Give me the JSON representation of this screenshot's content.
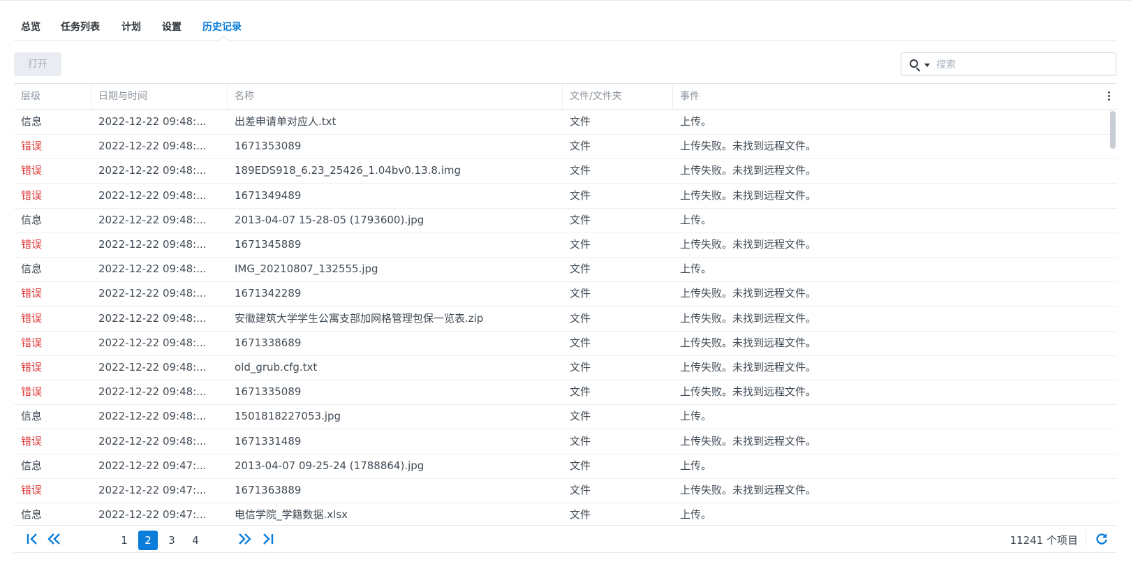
{
  "tabs": [
    {
      "label": "总览"
    },
    {
      "label": "任务列表"
    },
    {
      "label": "计划"
    },
    {
      "label": "设置"
    },
    {
      "label": "历史记录",
      "active": true
    }
  ],
  "toolbar": {
    "open_label": "打开",
    "search_placeholder": "搜索"
  },
  "table": {
    "columns": [
      "层级",
      "日期与时间",
      "名称",
      "文件/文件夹",
      "事件"
    ],
    "rows": [
      {
        "level": "信息",
        "error": false,
        "datetime": "2022-12-22 09:48:...",
        "name": "出差申请单对应人.txt",
        "type": "文件",
        "event": "上传。"
      },
      {
        "level": "错误",
        "error": true,
        "datetime": "2022-12-22 09:48:...",
        "name": "1671353089",
        "type": "文件",
        "event": "上传失败。未找到远程文件。"
      },
      {
        "level": "错误",
        "error": true,
        "datetime": "2022-12-22 09:48:...",
        "name": "189EDS918_6.23_25426_1.04bv0.13.8.img",
        "type": "文件",
        "event": "上传失败。未找到远程文件。"
      },
      {
        "level": "错误",
        "error": true,
        "datetime": "2022-12-22 09:48:...",
        "name": "1671349489",
        "type": "文件",
        "event": "上传失败。未找到远程文件。"
      },
      {
        "level": "信息",
        "error": false,
        "datetime": "2022-12-22 09:48:...",
        "name": "2013-04-07 15-28-05 (1793600).jpg",
        "type": "文件",
        "event": "上传。"
      },
      {
        "level": "错误",
        "error": true,
        "datetime": "2022-12-22 09:48:...",
        "name": "1671345889",
        "type": "文件",
        "event": "上传失败。未找到远程文件。"
      },
      {
        "level": "信息",
        "error": false,
        "datetime": "2022-12-22 09:48:...",
        "name": "IMG_20210807_132555.jpg",
        "type": "文件",
        "event": "上传。"
      },
      {
        "level": "错误",
        "error": true,
        "datetime": "2022-12-22 09:48:...",
        "name": "1671342289",
        "type": "文件",
        "event": "上传失败。未找到远程文件。"
      },
      {
        "level": "错误",
        "error": true,
        "datetime": "2022-12-22 09:48:...",
        "name": "安徽建筑大学学生公寓支部加网格管理包保一览表.zip",
        "type": "文件",
        "event": "上传失败。未找到远程文件。"
      },
      {
        "level": "错误",
        "error": true,
        "datetime": "2022-12-22 09:48:...",
        "name": "1671338689",
        "type": "文件",
        "event": "上传失败。未找到远程文件。"
      },
      {
        "level": "错误",
        "error": true,
        "datetime": "2022-12-22 09:48:...",
        "name": "old_grub.cfg.txt",
        "type": "文件",
        "event": "上传失败。未找到远程文件。"
      },
      {
        "level": "错误",
        "error": true,
        "datetime": "2022-12-22 09:48:...",
        "name": "1671335089",
        "type": "文件",
        "event": "上传失败。未找到远程文件。"
      },
      {
        "level": "信息",
        "error": false,
        "datetime": "2022-12-22 09:48:...",
        "name": "1501818227053.jpg",
        "type": "文件",
        "event": "上传。"
      },
      {
        "level": "错误",
        "error": true,
        "datetime": "2022-12-22 09:48:...",
        "name": "1671331489",
        "type": "文件",
        "event": "上传失败。未找到远程文件。"
      },
      {
        "level": "信息",
        "error": false,
        "datetime": "2022-12-22 09:47:...",
        "name": "2013-04-07 09-25-24 (1788864).jpg",
        "type": "文件",
        "event": "上传。"
      },
      {
        "level": "错误",
        "error": true,
        "datetime": "2022-12-22 09:47:...",
        "name": "1671363889",
        "type": "文件",
        "event": "上传失败。未找到远程文件。"
      },
      {
        "level": "信息",
        "error": false,
        "datetime": "2022-12-22 09:47:...",
        "name": "电信学院_学籍数据.xlsx",
        "type": "文件",
        "event": "上传。"
      }
    ]
  },
  "pagination": {
    "pages": [
      "1",
      "2",
      "3",
      "4"
    ],
    "current": "2",
    "total_text": "11241 个项目"
  },
  "colors": {
    "accent": "#0a7ddb",
    "error": "#e03b3b",
    "text": "#414b55"
  }
}
